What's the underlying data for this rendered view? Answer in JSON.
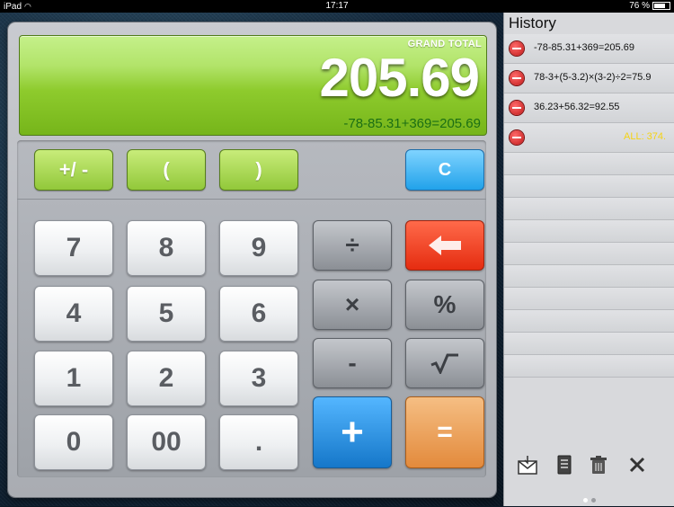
{
  "status_bar": {
    "device": "iPad",
    "time": "17:17",
    "battery": "76 %",
    "battery_level": 0.76
  },
  "display": {
    "label": "GRAND TOTAL",
    "result": "205.69",
    "expression": "-78-85.31+369=205.69"
  },
  "keys": {
    "sign": "+/ -",
    "paren_open": "(",
    "paren_close": ")",
    "clear": "C",
    "d7": "7",
    "d8": "8",
    "d9": "9",
    "d4": "4",
    "d5": "5",
    "d6": "6",
    "d1": "1",
    "d2": "2",
    "d3": "3",
    "d0": "0",
    "d00": "00",
    "dot": ".",
    "divide": "÷",
    "multiply": "×",
    "percent": "%",
    "minus": "-",
    "plus": "+",
    "equals": "="
  },
  "history": {
    "title": "History",
    "entries": [
      "-78-85.31+369=205.69",
      "78-3+(5-3.2)×(3-2)÷2=75.9",
      "36.23+56.32=92.55"
    ],
    "total": "ALL: 374."
  },
  "colors": {
    "display_green": "#8ecb2d",
    "clear_blue": "#21a2ea",
    "backspace_red": "#e52c10",
    "plus_blue": "#1577c9",
    "equals_orange": "#e38a3c",
    "history_total": "#f5d313"
  },
  "icons": {
    "backspace": "arrow-left-icon",
    "sqrt": "square-root-icon",
    "mail": "mail-icon",
    "document": "document-icon",
    "trash": "trash-icon",
    "close": "close-icon",
    "remove": "minus-circle-icon"
  }
}
